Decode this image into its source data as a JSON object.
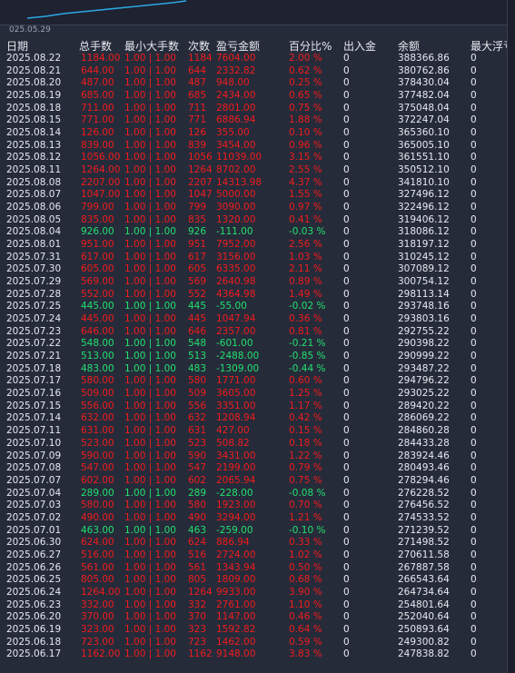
{
  "chart": {
    "date_label": "025.05.29"
  },
  "columns": {
    "date": "日期",
    "total_lots": "总手数",
    "min_max_lots": "最小大手数",
    "count": "次数",
    "pnl": "盈亏金额",
    "pct": "百分比%",
    "in_out": "出入金",
    "balance": "余额",
    "max_float": "最大浮亏"
  },
  "rows": [
    {
      "date": "2025.08.22",
      "total": "1184.00",
      "minmax": "1.00 | 1.00",
      "count": "1184",
      "pnl": "7604.00",
      "pct": "2.00 %",
      "flow": "0",
      "bal": "388366.86",
      "float": "0",
      "dir": "up"
    },
    {
      "date": "2025.08.21",
      "total": "644.00",
      "minmax": "1.00 | 1.00",
      "count": "644",
      "pnl": "2332.82",
      "pct": "0.62 %",
      "flow": "0",
      "bal": "380762.86",
      "float": "0",
      "dir": "up"
    },
    {
      "date": "2025.08.20",
      "total": "487.00",
      "minmax": "1.00 | 1.00",
      "count": "487",
      "pnl": "948.00",
      "pct": "0.25 %",
      "flow": "0",
      "bal": "378430.04",
      "float": "0",
      "dir": "up"
    },
    {
      "date": "2025.08.19",
      "total": "685.00",
      "minmax": "1.00 | 1.00",
      "count": "685",
      "pnl": "2434.00",
      "pct": "0.65 %",
      "flow": "0",
      "bal": "377482.04",
      "float": "0",
      "dir": "up"
    },
    {
      "date": "2025.08.18",
      "total": "711.00",
      "minmax": "1.00 | 1.00",
      "count": "711",
      "pnl": "2801.00",
      "pct": "0.75 %",
      "flow": "0",
      "bal": "375048.04",
      "float": "0",
      "dir": "up"
    },
    {
      "date": "2025.08.15",
      "total": "771.00",
      "minmax": "1.00 | 1.00",
      "count": "771",
      "pnl": "6886.94",
      "pct": "1.88 %",
      "flow": "0",
      "bal": "372247.04",
      "float": "0",
      "dir": "up"
    },
    {
      "date": "2025.08.14",
      "total": "126.00",
      "minmax": "1.00 | 1.00",
      "count": "126",
      "pnl": "355.00",
      "pct": "0.10 %",
      "flow": "0",
      "bal": "365360.10",
      "float": "0",
      "dir": "up"
    },
    {
      "date": "2025.08.13",
      "total": "839.00",
      "minmax": "1.00 | 1.00",
      "count": "839",
      "pnl": "3454.00",
      "pct": "0.96 %",
      "flow": "0",
      "bal": "365005.10",
      "float": "0",
      "dir": "up"
    },
    {
      "date": "2025.08.12",
      "total": "1056.00",
      "minmax": "1.00 | 1.00",
      "count": "1056",
      "pnl": "11039.00",
      "pct": "3.15 %",
      "flow": "0",
      "bal": "361551.10",
      "float": "0",
      "dir": "up"
    },
    {
      "date": "2025.08.11",
      "total": "1264.00",
      "minmax": "1.00 | 1.00",
      "count": "1264",
      "pnl": "8702.00",
      "pct": "2.55 %",
      "flow": "0",
      "bal": "350512.10",
      "float": "0",
      "dir": "up"
    },
    {
      "date": "2025.08.08",
      "total": "2207.00",
      "minmax": "1.00 | 1.00",
      "count": "2207",
      "pnl": "14313.98",
      "pct": "4.37 %",
      "flow": "0",
      "bal": "341810.10",
      "float": "0",
      "dir": "up"
    },
    {
      "date": "2025.08.07",
      "total": "1047.00",
      "minmax": "1.00 | 1.00",
      "count": "1047",
      "pnl": "5000.00",
      "pct": "1.55 %",
      "flow": "0",
      "bal": "327496.12",
      "float": "0",
      "dir": "up"
    },
    {
      "date": "2025.08.06",
      "total": "799.00",
      "minmax": "1.00 | 1.00",
      "count": "799",
      "pnl": "3090.00",
      "pct": "0.97 %",
      "flow": "0",
      "bal": "322496.12",
      "float": "0",
      "dir": "up"
    },
    {
      "date": "2025.08.05",
      "total": "835.00",
      "minmax": "1.00 | 1.00",
      "count": "835",
      "pnl": "1320.00",
      "pct": "0.41 %",
      "flow": "0",
      "bal": "319406.12",
      "float": "0",
      "dir": "up"
    },
    {
      "date": "2025.08.04",
      "total": "926.00",
      "minmax": "1.00 | 1.00",
      "count": "926",
      "pnl": "-111.00",
      "pct": "-0.03 %",
      "flow": "0",
      "bal": "318086.12",
      "float": "0",
      "dir": "down"
    },
    {
      "date": "2025.08.01",
      "total": "951.00",
      "minmax": "1.00 | 1.00",
      "count": "951",
      "pnl": "7952.00",
      "pct": "2.56 %",
      "flow": "0",
      "bal": "318197.12",
      "float": "0",
      "dir": "up"
    },
    {
      "date": "2025.07.31",
      "total": "617.00",
      "minmax": "1.00 | 1.00",
      "count": "617",
      "pnl": "3156.00",
      "pct": "1.03 %",
      "flow": "0",
      "bal": "310245.12",
      "float": "0",
      "dir": "up"
    },
    {
      "date": "2025.07.30",
      "total": "605.00",
      "minmax": "1.00 | 1.00",
      "count": "605",
      "pnl": "6335.00",
      "pct": "2.11 %",
      "flow": "0",
      "bal": "307089.12",
      "float": "0",
      "dir": "up"
    },
    {
      "date": "2025.07.29",
      "total": "569.00",
      "minmax": "1.00 | 1.00",
      "count": "569",
      "pnl": "2640.98",
      "pct": "0.89 %",
      "flow": "0",
      "bal": "300754.12",
      "float": "0",
      "dir": "up"
    },
    {
      "date": "2025.07.28",
      "total": "552.00",
      "minmax": "1.00 | 1.00",
      "count": "552",
      "pnl": "4364.98",
      "pct": "1.49 %",
      "flow": "0",
      "bal": "298113.14",
      "float": "0",
      "dir": "up"
    },
    {
      "date": "2025.07.25",
      "total": "445.00",
      "minmax": "1.00 | 1.00",
      "count": "445",
      "pnl": "-55.00",
      "pct": "-0.02 %",
      "flow": "0",
      "bal": "293748.16",
      "float": "0",
      "dir": "down"
    },
    {
      "date": "2025.07.24",
      "total": "445.00",
      "minmax": "1.00 | 1.00",
      "count": "445",
      "pnl": "1047.94",
      "pct": "0.36 %",
      "flow": "0",
      "bal": "293803.16",
      "float": "0",
      "dir": "up"
    },
    {
      "date": "2025.07.23",
      "total": "646.00",
      "minmax": "1.00 | 1.00",
      "count": "646",
      "pnl": "2357.00",
      "pct": "0.81 %",
      "flow": "0",
      "bal": "292755.22",
      "float": "0",
      "dir": "up"
    },
    {
      "date": "2025.07.22",
      "total": "548.00",
      "minmax": "1.00 | 1.00",
      "count": "548",
      "pnl": "-601.00",
      "pct": "-0.21 %",
      "flow": "0",
      "bal": "290398.22",
      "float": "0",
      "dir": "down"
    },
    {
      "date": "2025.07.21",
      "total": "513.00",
      "minmax": "1.00 | 1.00",
      "count": "513",
      "pnl": "-2488.00",
      "pct": "-0.85 %",
      "flow": "0",
      "bal": "290999.22",
      "float": "0",
      "dir": "down"
    },
    {
      "date": "2025.07.18",
      "total": "483.00",
      "minmax": "1.00 | 1.00",
      "count": "483",
      "pnl": "-1309.00",
      "pct": "-0.44 %",
      "flow": "0",
      "bal": "293487.22",
      "float": "0",
      "dir": "down"
    },
    {
      "date": "2025.07.17",
      "total": "580.00",
      "minmax": "1.00 | 1.00",
      "count": "580",
      "pnl": "1771.00",
      "pct": "0.60 %",
      "flow": "0",
      "bal": "294796.22",
      "float": "0",
      "dir": "up"
    },
    {
      "date": "2025.07.16",
      "total": "509.00",
      "minmax": "1.00 | 1.00",
      "count": "509",
      "pnl": "3605.00",
      "pct": "1.25 %",
      "flow": "0",
      "bal": "293025.22",
      "float": "0",
      "dir": "up"
    },
    {
      "date": "2025.07.15",
      "total": "556.00",
      "minmax": "1.00 | 1.00",
      "count": "556",
      "pnl": "3351.00",
      "pct": "1.17 %",
      "flow": "0",
      "bal": "289420.22",
      "float": "0",
      "dir": "up"
    },
    {
      "date": "2025.07.14",
      "total": "632.00",
      "minmax": "1.00 | 1.00",
      "count": "632",
      "pnl": "1208.94",
      "pct": "0.42 %",
      "flow": "0",
      "bal": "286069.22",
      "float": "0",
      "dir": "up"
    },
    {
      "date": "2025.07.11",
      "total": "631.00",
      "minmax": "1.00 | 1.00",
      "count": "631",
      "pnl": "427.00",
      "pct": "0.15 %",
      "flow": "0",
      "bal": "284860.28",
      "float": "0",
      "dir": "up"
    },
    {
      "date": "2025.07.10",
      "total": "523.00",
      "minmax": "1.00 | 1.00",
      "count": "523",
      "pnl": "508.82",
      "pct": "0.18 %",
      "flow": "0",
      "bal": "284433.28",
      "float": "0",
      "dir": "up"
    },
    {
      "date": "2025.07.09",
      "total": "590.00",
      "minmax": "1.00 | 1.00",
      "count": "590",
      "pnl": "3431.00",
      "pct": "1.22 %",
      "flow": "0",
      "bal": "283924.46",
      "float": "0",
      "dir": "up"
    },
    {
      "date": "2025.07.08",
      "total": "547.00",
      "minmax": "1.00 | 1.00",
      "count": "547",
      "pnl": "2199.00",
      "pct": "0.79 %",
      "flow": "0",
      "bal": "280493.46",
      "float": "0",
      "dir": "up"
    },
    {
      "date": "2025.07.07",
      "total": "602.00",
      "minmax": "1.00 | 1.00",
      "count": "602",
      "pnl": "2065.94",
      "pct": "0.75 %",
      "flow": "0",
      "bal": "278294.46",
      "float": "0",
      "dir": "up"
    },
    {
      "date": "2025.07.04",
      "total": "289.00",
      "minmax": "1.00 | 1.00",
      "count": "289",
      "pnl": "-228.00",
      "pct": "-0.08 %",
      "flow": "0",
      "bal": "276228.52",
      "float": "0",
      "dir": "down"
    },
    {
      "date": "2025.07.03",
      "total": "580.00",
      "minmax": "1.00 | 1.00",
      "count": "580",
      "pnl": "1923.00",
      "pct": "0.70 %",
      "flow": "0",
      "bal": "276456.52",
      "float": "0",
      "dir": "up"
    },
    {
      "date": "2025.07.02",
      "total": "490.00",
      "minmax": "1.00 | 1.00",
      "count": "490",
      "pnl": "3294.00",
      "pct": "1.21 %",
      "flow": "0",
      "bal": "274533.52",
      "float": "0",
      "dir": "up"
    },
    {
      "date": "2025.07.01",
      "total": "463.00",
      "minmax": "1.00 | 1.00",
      "count": "463",
      "pnl": "-259.00",
      "pct": "-0.10 %",
      "flow": "0",
      "bal": "271239.52",
      "float": "0",
      "dir": "down"
    },
    {
      "date": "2025.06.30",
      "total": "624.00",
      "minmax": "1.00 | 1.00",
      "count": "624",
      "pnl": "886.94",
      "pct": "0.33 %",
      "flow": "0",
      "bal": "271498.52",
      "float": "0",
      "dir": "up"
    },
    {
      "date": "2025.06.27",
      "total": "516.00",
      "minmax": "1.00 | 1.00",
      "count": "516",
      "pnl": "2724.00",
      "pct": "1.02 %",
      "flow": "0",
      "bal": "270611.58",
      "float": "0",
      "dir": "up"
    },
    {
      "date": "2025.06.26",
      "total": "561.00",
      "minmax": "1.00 | 1.00",
      "count": "561",
      "pnl": "1343.94",
      "pct": "0.50 %",
      "flow": "0",
      "bal": "267887.58",
      "float": "0",
      "dir": "up"
    },
    {
      "date": "2025.06.25",
      "total": "805.00",
      "minmax": "1.00 | 1.00",
      "count": "805",
      "pnl": "1809.00",
      "pct": "0.68 %",
      "flow": "0",
      "bal": "266543.64",
      "float": "0",
      "dir": "up"
    },
    {
      "date": "2025.06.24",
      "total": "1264.00",
      "minmax": "1.00 | 1.00",
      "count": "1264",
      "pnl": "9933.00",
      "pct": "3.90 %",
      "flow": "0",
      "bal": "264734.64",
      "float": "0",
      "dir": "up"
    },
    {
      "date": "2025.06.23",
      "total": "332.00",
      "minmax": "1.00 | 1.00",
      "count": "332",
      "pnl": "2761.00",
      "pct": "1.10 %",
      "flow": "0",
      "bal": "254801.64",
      "float": "0",
      "dir": "up"
    },
    {
      "date": "2025.06.20",
      "total": "370.00",
      "minmax": "1.00 | 1.00",
      "count": "370",
      "pnl": "1147.00",
      "pct": "0.46 %",
      "flow": "0",
      "bal": "252040.64",
      "float": "0",
      "dir": "up"
    },
    {
      "date": "2025.06.19",
      "total": "323.00",
      "minmax": "1.00 | 1.00",
      "count": "323",
      "pnl": "1592.82",
      "pct": "0.64 %",
      "flow": "0",
      "bal": "250893.64",
      "float": "0",
      "dir": "up"
    },
    {
      "date": "2025.06.18",
      "total": "723.00",
      "minmax": "1.00 | 1.00",
      "count": "723",
      "pnl": "1462.00",
      "pct": "0.59 %",
      "flow": "0",
      "bal": "249300.82",
      "float": "0",
      "dir": "up"
    },
    {
      "date": "2025.06.17",
      "total": "1162.00",
      "minmax": "1.00 | 1.00",
      "count": "1162",
      "pnl": "9148.00",
      "pct": "3.83 %",
      "flow": "0",
      "bal": "247838.82",
      "float": "0",
      "dir": "up"
    }
  ]
}
